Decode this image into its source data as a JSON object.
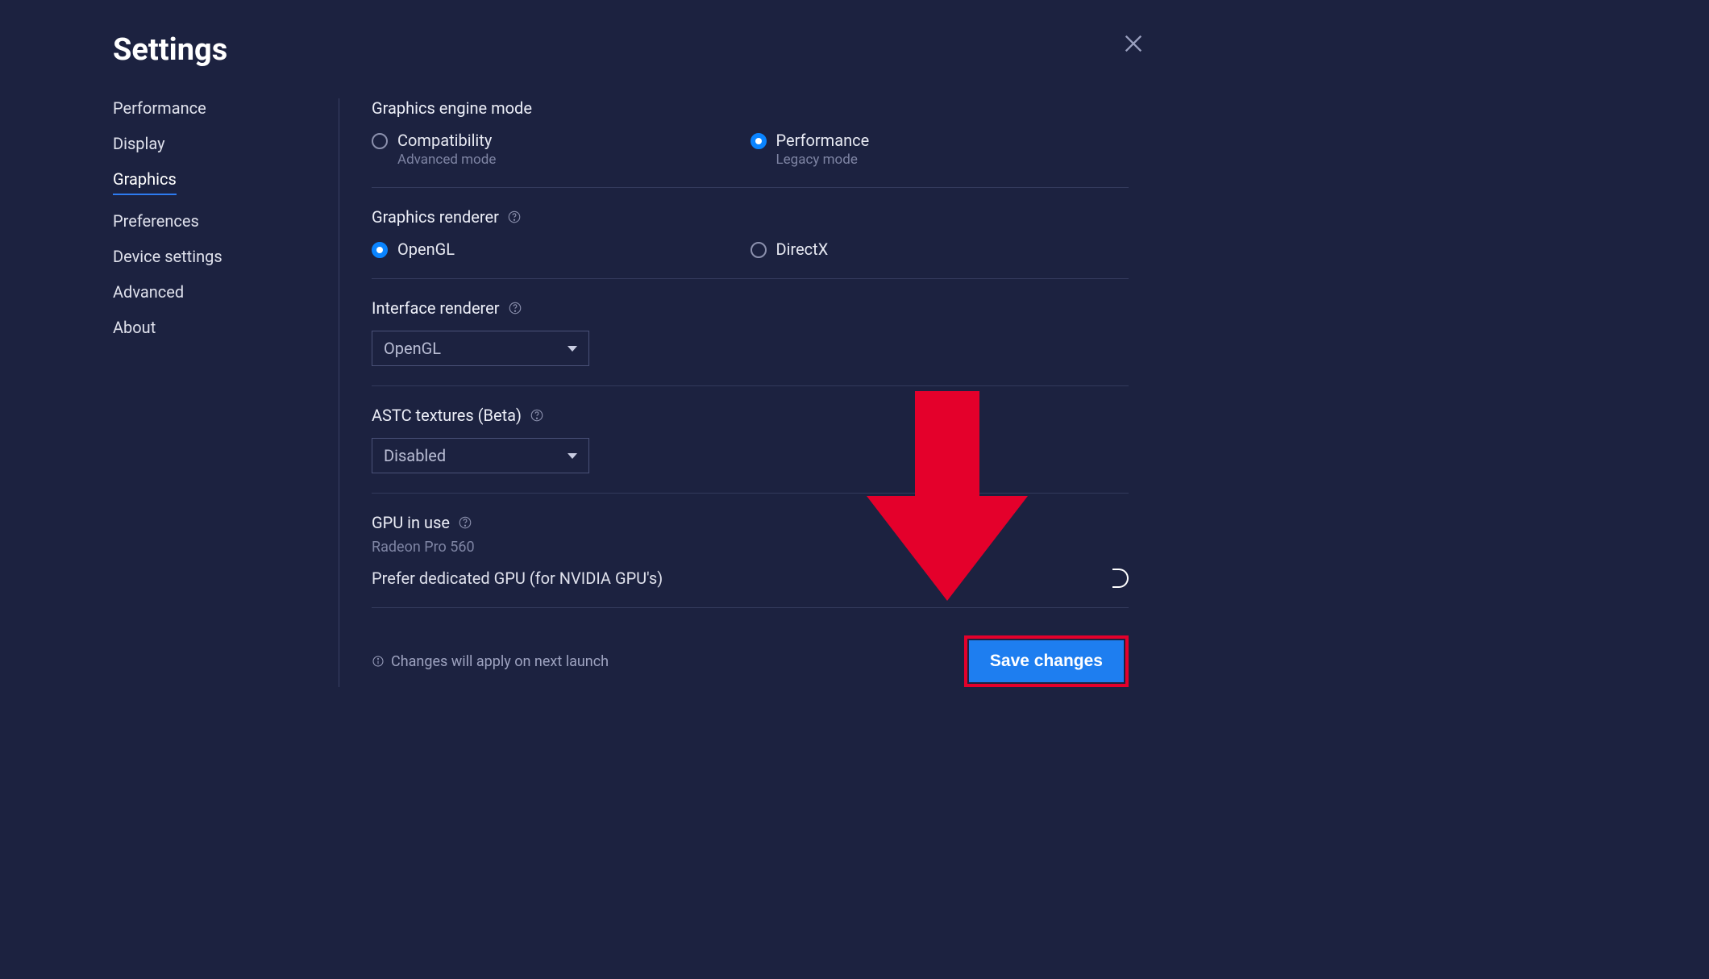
{
  "header": {
    "title": "Settings"
  },
  "sidebar": {
    "items": [
      {
        "label": "Performance",
        "active": false
      },
      {
        "label": "Display",
        "active": false
      },
      {
        "label": "Graphics",
        "active": true
      },
      {
        "label": "Preferences",
        "active": false
      },
      {
        "label": "Device settings",
        "active": false
      },
      {
        "label": "Advanced",
        "active": false
      },
      {
        "label": "About",
        "active": false
      }
    ]
  },
  "graphics": {
    "engine_mode": {
      "title": "Graphics engine mode",
      "options": [
        {
          "label": "Compatibility",
          "sub": "Advanced mode",
          "checked": false
        },
        {
          "label": "Performance",
          "sub": "Legacy mode",
          "checked": true
        }
      ]
    },
    "renderer": {
      "title": "Graphics renderer",
      "options": [
        {
          "label": "OpenGL",
          "checked": true
        },
        {
          "label": "DirectX",
          "checked": false
        }
      ]
    },
    "interface_renderer": {
      "title": "Interface renderer",
      "value": "OpenGL"
    },
    "astc": {
      "title": "ASTC textures (Beta)",
      "value": "Disabled"
    },
    "gpu": {
      "title": "GPU in use",
      "value": "Radeon Pro 560",
      "pref_label": "Prefer dedicated GPU (for NVIDIA GPU's)"
    }
  },
  "footer": {
    "note": "Changes will apply on next launch",
    "save": "Save changes"
  },
  "annotation": {
    "arrow_color": "#e4002b"
  }
}
